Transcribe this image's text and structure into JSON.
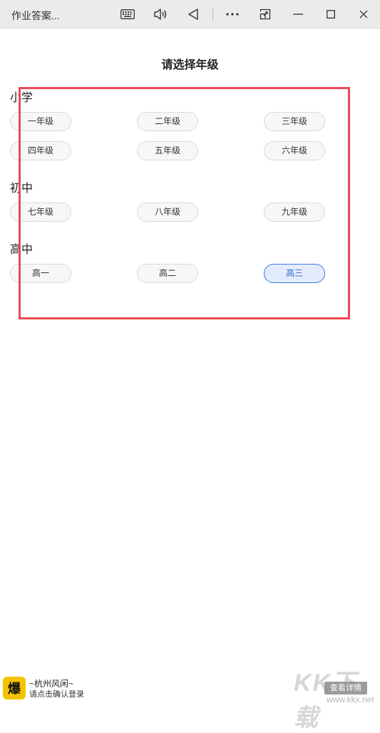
{
  "window": {
    "title": "作业答案..."
  },
  "page_title": "请选择年级",
  "sections": [
    {
      "title": "小学",
      "grades": [
        "一年级",
        "二年级",
        "三年级",
        "四年级",
        "五年级",
        "六年级"
      ]
    },
    {
      "title": "初中",
      "grades": [
        "七年级",
        "八年级",
        "九年级"
      ]
    },
    {
      "title": "高中",
      "grades": [
        "高一",
        "高二",
        "高三"
      ]
    }
  ],
  "selected_grade": "高三",
  "ad": {
    "logo_char": "爆",
    "title": "~杭州风闲~",
    "subtitle": "请点击确认登录",
    "button_label": "查看详情"
  },
  "watermark": {
    "text": "KK下载",
    "url": "www.kkx.net"
  },
  "colors": {
    "accent": "#2a66d6",
    "highlight_border": "#ea4a54"
  }
}
